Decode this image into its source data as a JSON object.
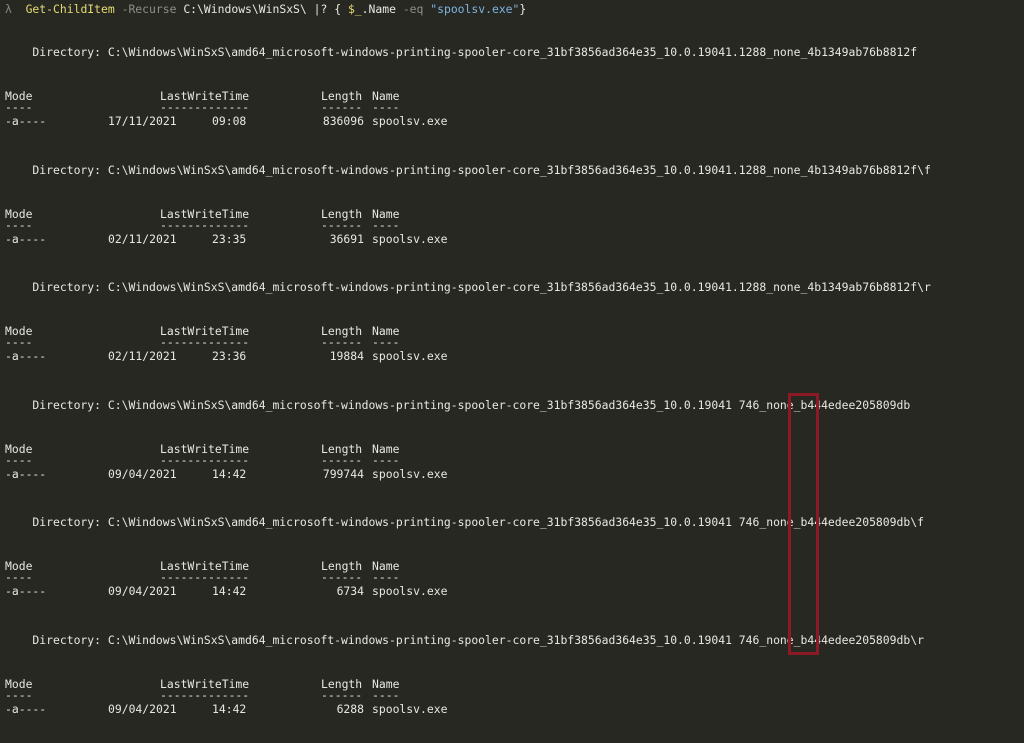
{
  "prompt": {
    "symbol": "λ",
    "cmdlet": "Get-ChildItem",
    "switch": "-Recurse",
    "path": "C:\\Windows\\WinSxS\\",
    "pipe": "|?",
    "open_brace": "{",
    "var_dollar": "$_",
    "property": ".Name",
    "operator": "-eq",
    "value": "\"spoolsv.exe\"",
    "close_brace": "}"
  },
  "headers": {
    "mode": "Mode",
    "lastwrite": "LastWriteTime",
    "length": "Length",
    "name": "Name",
    "mode_dash": "----",
    "lastwrite_dash": "-------------",
    "length_dash": "------",
    "name_dash": "----"
  },
  "blocks": [
    {
      "directory": "    Directory: C:\\Windows\\WinSxS\\amd64_microsoft-windows-printing-spooler-core_31bf3856ad364e35_10.0.19041.1288_none_4b1349ab76b8812f",
      "mode": "-a----",
      "date": "17/11/2021",
      "time": "09:08",
      "length": "836096",
      "name": "spoolsv.exe"
    },
    {
      "directory": "    Directory: C:\\Windows\\WinSxS\\amd64_microsoft-windows-printing-spooler-core_31bf3856ad364e35_10.0.19041.1288_none_4b1349ab76b8812f\\f",
      "mode": "-a----",
      "date": "02/11/2021",
      "time": "23:35",
      "length": "36691",
      "name": "spoolsv.exe"
    },
    {
      "directory": "    Directory: C:\\Windows\\WinSxS\\amd64_microsoft-windows-printing-spooler-core_31bf3856ad364e35_10.0.19041.1288_none_4b1349ab76b8812f\\r",
      "mode": "-a----",
      "date": "02/11/2021",
      "time": "23:36",
      "length": "19884",
      "name": "spoolsv.exe"
    },
    {
      "directory": "    Directory: C:\\Windows\\WinSxS\\amd64_microsoft-windows-printing-spooler-core_31bf3856ad364e35_10.0.19041 746_none_b444edee205809db",
      "mode": "-a----",
      "date": "09/04/2021",
      "time": "14:42",
      "length": "799744",
      "name": "spoolsv.exe"
    },
    {
      "directory": "    Directory: C:\\Windows\\WinSxS\\amd64_microsoft-windows-printing-spooler-core_31bf3856ad364e35_10.0.19041 746_none_b444edee205809db\\f",
      "mode": "-a----",
      "date": "09/04/2021",
      "time": "14:42",
      "length": "6734",
      "name": "spoolsv.exe"
    },
    {
      "directory": "    Directory: C:\\Windows\\WinSxS\\amd64_microsoft-windows-printing-spooler-core_31bf3856ad364e35_10.0.19041 746_none_b444edee205809db\\r",
      "mode": "-a----",
      "date": "09/04/2021",
      "time": "14:42",
      "length": "6288",
      "name": "spoolsv.exe"
    }
  ],
  "colors": {
    "background": "#272822",
    "text": "#e8e8e2",
    "cmdlet": "#e6db74",
    "string": "#7fb2e0",
    "highlight_box": "#8b1a24"
  }
}
